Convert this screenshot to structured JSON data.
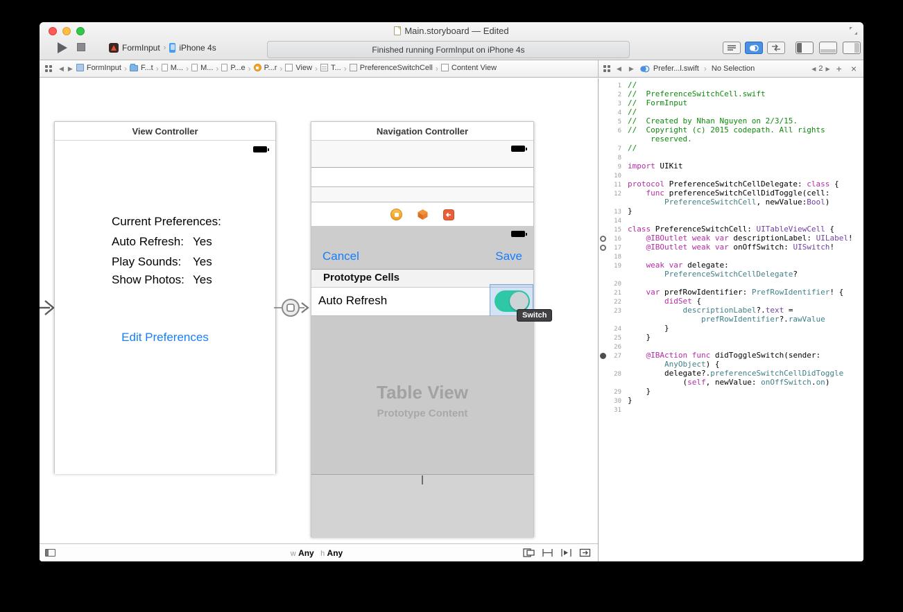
{
  "window": {
    "title": "Main.storyboard — Edited"
  },
  "toolbar": {
    "scheme_name": "FormInput",
    "device_name": "iPhone 4s",
    "status_text": "Finished running FormInput on iPhone 4s"
  },
  "jumpbar": {
    "left_items": [
      {
        "label": "FormInput",
        "icon": "project"
      },
      {
        "label": "F...t",
        "icon": "folder"
      },
      {
        "label": "M...",
        "icon": "doc"
      },
      {
        "label": "M...",
        "icon": "doc"
      },
      {
        "label": "P...e",
        "icon": "doc"
      },
      {
        "label": "P...r",
        "icon": "vc"
      },
      {
        "label": "View",
        "icon": "view"
      },
      {
        "label": "T...",
        "icon": "table"
      },
      {
        "label": "PreferenceSwitchCell",
        "icon": "cell"
      },
      {
        "label": "Content View",
        "icon": "view"
      }
    ],
    "right_file": "Prefer...l.swift",
    "right_selection": "No Selection",
    "counter": "2",
    "add_label": "+",
    "close_label": "×"
  },
  "canvas": {
    "scene1": {
      "title": "View Controller",
      "rows": [
        {
          "name": "Current Preferences:",
          "value": ""
        },
        {
          "name": "Auto Refresh:",
          "value": "Yes"
        },
        {
          "name": "Play Sounds:",
          "value": "Yes"
        },
        {
          "name": "Show Photos:",
          "value": "Yes"
        }
      ],
      "button_label": "Edit Preferences"
    },
    "scene2": {
      "title": "Navigation Controller",
      "cancel_label": "Cancel",
      "save_label": "Save",
      "section_label": "Prototype Cells",
      "cell_label": "Auto Refresh",
      "tooltip": "Switch",
      "table_placeholder_title": "Table View",
      "table_placeholder_subtitle": "Prototype Content"
    },
    "size_bar": {
      "w_key": "w",
      "w_value": "Any",
      "h_key": "h",
      "h_value": "Any"
    }
  },
  "code": {
    "rows": [
      {
        "n": "1",
        "g": "",
        "s": [
          [
            "//",
            "c"
          ]
        ]
      },
      {
        "n": "2",
        "g": "",
        "s": [
          [
            "//  PreferenceSwitchCell.swift",
            "c"
          ]
        ]
      },
      {
        "n": "3",
        "g": "",
        "s": [
          [
            "//  FormInput",
            "c"
          ]
        ]
      },
      {
        "n": "4",
        "g": "",
        "s": [
          [
            "//",
            "c"
          ]
        ]
      },
      {
        "n": "5",
        "g": "",
        "s": [
          [
            "//  Created by Nhan Nguyen on 2/3/15.",
            "c"
          ]
        ]
      },
      {
        "n": "6",
        "g": "",
        "s": [
          [
            "//  Copyright (c) 2015 codepath. All rights",
            "c"
          ]
        ]
      },
      {
        "n": "",
        "g": "",
        "s": [
          [
            "     reserved.",
            "c"
          ]
        ]
      },
      {
        "n": "7",
        "g": "",
        "s": [
          [
            "//",
            "c"
          ]
        ]
      },
      {
        "n": "8",
        "g": "",
        "s": []
      },
      {
        "n": "9",
        "g": "",
        "s": [
          [
            "import",
            "k"
          ],
          [
            " UIKit",
            "pl"
          ]
        ]
      },
      {
        "n": "10",
        "g": "",
        "s": []
      },
      {
        "n": "11",
        "g": "",
        "s": [
          [
            "protocol",
            "k"
          ],
          [
            " PreferenceSwitchCellDelegate: ",
            "pl"
          ],
          [
            "class",
            "k"
          ],
          [
            " {",
            "pl"
          ]
        ]
      },
      {
        "n": "12",
        "g": "",
        "s": [
          [
            "    ",
            "pl"
          ],
          [
            "func",
            "k"
          ],
          [
            " preferenceSwitchCellDidToggle(cell:",
            "pl"
          ]
        ]
      },
      {
        "n": "",
        "g": "",
        "s": [
          [
            "        ",
            "pl"
          ],
          [
            "PreferenceSwitchCell",
            "t"
          ],
          [
            ", newValue:",
            "pl"
          ],
          [
            "Bool",
            "fw"
          ],
          [
            ")",
            "pl"
          ]
        ]
      },
      {
        "n": "13",
        "g": "",
        "s": [
          [
            "}",
            "pl"
          ]
        ]
      },
      {
        "n": "14",
        "g": "",
        "s": []
      },
      {
        "n": "15",
        "g": "",
        "s": [
          [
            "class",
            "k"
          ],
          [
            " PreferenceSwitchCell: ",
            "pl"
          ],
          [
            "UITableViewCell",
            "fw"
          ],
          [
            " {",
            "pl"
          ]
        ]
      },
      {
        "n": "16",
        "g": "outlet",
        "s": [
          [
            "    ",
            "pl"
          ],
          [
            "@IBOutlet",
            "k"
          ],
          [
            " ",
            "pl"
          ],
          [
            "weak",
            "k"
          ],
          [
            " ",
            "pl"
          ],
          [
            "var",
            "k"
          ],
          [
            " descriptionLabel: ",
            "pl"
          ],
          [
            "UILabel",
            "fw"
          ],
          [
            "!",
            "pl"
          ]
        ]
      },
      {
        "n": "17",
        "g": "outlet",
        "s": [
          [
            "    ",
            "pl"
          ],
          [
            "@IBOutlet",
            "k"
          ],
          [
            " ",
            "pl"
          ],
          [
            "weak",
            "k"
          ],
          [
            " ",
            "pl"
          ],
          [
            "var",
            "k"
          ],
          [
            " onOffSwitch: ",
            "pl"
          ],
          [
            "UISwitch",
            "fw"
          ],
          [
            "!",
            "pl"
          ]
        ]
      },
      {
        "n": "18",
        "g": "",
        "s": []
      },
      {
        "n": "19",
        "g": "",
        "s": [
          [
            "    ",
            "pl"
          ],
          [
            "weak",
            "k"
          ],
          [
            " ",
            "pl"
          ],
          [
            "var",
            "k"
          ],
          [
            " delegate:",
            "pl"
          ]
        ]
      },
      {
        "n": "",
        "g": "",
        "s": [
          [
            "        ",
            "pl"
          ],
          [
            "PreferenceSwitchCellDelegate",
            "t"
          ],
          [
            "?",
            "pl"
          ]
        ]
      },
      {
        "n": "20",
        "g": "",
        "s": []
      },
      {
        "n": "21",
        "g": "",
        "s": [
          [
            "    ",
            "pl"
          ],
          [
            "var",
            "k"
          ],
          [
            " prefRowIdentifier: ",
            "pl"
          ],
          [
            "PrefRowIdentifier",
            "t"
          ],
          [
            "! {",
            "pl"
          ]
        ]
      },
      {
        "n": "22",
        "g": "",
        "s": [
          [
            "        ",
            "pl"
          ],
          [
            "didSet",
            "k"
          ],
          [
            " {",
            "pl"
          ]
        ]
      },
      {
        "n": "23",
        "g": "",
        "s": [
          [
            "            ",
            "pl"
          ],
          [
            "descriptionLabel",
            "t"
          ],
          [
            "?.",
            "pl"
          ],
          [
            "text",
            "fw"
          ],
          [
            " =",
            "pl"
          ]
        ]
      },
      {
        "n": "",
        "g": "",
        "s": [
          [
            "                ",
            "pl"
          ],
          [
            "prefRowIdentifier",
            "t"
          ],
          [
            "?.",
            "pl"
          ],
          [
            "rawValue",
            "t"
          ]
        ]
      },
      {
        "n": "24",
        "g": "",
        "s": [
          [
            "        }",
            "pl"
          ]
        ]
      },
      {
        "n": "25",
        "g": "",
        "s": [
          [
            "    }",
            "pl"
          ]
        ]
      },
      {
        "n": "26",
        "g": "",
        "s": []
      },
      {
        "n": "27",
        "g": "action",
        "s": [
          [
            "    ",
            "pl"
          ],
          [
            "@IBAction",
            "k"
          ],
          [
            " ",
            "pl"
          ],
          [
            "func",
            "k"
          ],
          [
            " didToggleSwitch(sender:",
            "pl"
          ]
        ]
      },
      {
        "n": "",
        "g": "",
        "s": [
          [
            "        ",
            "pl"
          ],
          [
            "AnyObject",
            "t"
          ],
          [
            ") {",
            "pl"
          ]
        ]
      },
      {
        "n": "28",
        "g": "",
        "s": [
          [
            "        delegate?.",
            "pl"
          ],
          [
            "preferenceSwitchCellDidToggle",
            "t"
          ]
        ]
      },
      {
        "n": "",
        "g": "",
        "s": [
          [
            "            (",
            "pl"
          ],
          [
            "self",
            "k"
          ],
          [
            ", newValue: ",
            "pl"
          ],
          [
            "onOffSwitch",
            "t"
          ],
          [
            ".",
            "pl"
          ],
          [
            "on",
            "t"
          ],
          [
            ")",
            "pl"
          ]
        ]
      },
      {
        "n": "29",
        "g": "",
        "s": [
          [
            "    }",
            "pl"
          ]
        ]
      },
      {
        "n": "30",
        "g": "",
        "s": [
          [
            "}",
            "pl"
          ]
        ]
      },
      {
        "n": "31",
        "g": "",
        "s": []
      }
    ]
  },
  "colors": {
    "ios_blue": "#157efb",
    "switch_green": "#2ec8a6",
    "comment": "#0c8a0c",
    "keyword": "#b62ba5",
    "type_project": "#3e8087",
    "type_framework": "#7040a5"
  },
  "icons": {
    "run": "play-triangle",
    "stop": "square",
    "related_items": "grid-2x2",
    "assistant_editor": "two-circles",
    "battery": "black-rounded-rect",
    "segue": "circle-with-square",
    "connection_well": "ring-circle",
    "action_well": "filled-circle"
  }
}
